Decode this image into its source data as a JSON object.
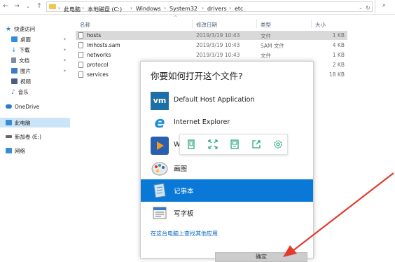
{
  "address": {
    "crumbs": [
      "此电脑",
      "本地磁盘 (C:)",
      "Windows",
      "System32",
      "drivers",
      "etc"
    ]
  },
  "sidebar": {
    "items": [
      {
        "label": "快速访问",
        "icon": "star-icon",
        "color": "#2b7fd1"
      },
      {
        "label": "桌面",
        "icon": "desktop-icon",
        "color": "#2f8fdd",
        "pinned": true
      },
      {
        "label": "下载",
        "icon": "download-icon",
        "color": "#2f8fdd",
        "pinned": true
      },
      {
        "label": "文档",
        "icon": "document-icon",
        "color": "#7a8ea3",
        "pinned": true
      },
      {
        "label": "图片",
        "icon": "picture-icon",
        "color": "#3a7dc8",
        "pinned": true
      },
      {
        "label": "视频",
        "icon": "video-icon",
        "color": "#4a5f80"
      },
      {
        "label": "音乐",
        "icon": "music-icon",
        "color": "#3d7fd0"
      },
      {
        "label": "OneDrive",
        "icon": "cloud-icon",
        "color": "#2b78d0"
      },
      {
        "label": "此电脑",
        "icon": "computer-icon",
        "color": "#3b8bd6",
        "selected": true
      },
      {
        "label": "新加卷 (E:)",
        "icon": "drive-icon",
        "color": "#666666"
      },
      {
        "label": "网络",
        "icon": "network-icon",
        "color": "#3b8bd6"
      }
    ]
  },
  "columns": {
    "name": "名称",
    "modified": "修改日期",
    "type": "类型",
    "size": "大小"
  },
  "files": [
    {
      "name": "hosts",
      "modified": "2019/3/19 10:43",
      "type": "文件",
      "size": "1 KB",
      "selected": true
    },
    {
      "name": "lmhosts.sam",
      "modified": "2019/3/19 10:43",
      "type": "SAM 文件",
      "size": "4 KB"
    },
    {
      "name": "networks",
      "modified": "2019/3/19 10:43",
      "type": "文件",
      "size": "1 KB"
    },
    {
      "name": "protocol",
      "modified": "",
      "type": "",
      "size": "2 KB"
    },
    {
      "name": "services",
      "modified": "",
      "type": "",
      "size": "18 KB"
    }
  ],
  "dialog": {
    "title": "你要如何打开这个文件?",
    "apps": [
      {
        "label": "Default Host Application",
        "icon": "vm-icon",
        "icon_text": "vm"
      },
      {
        "label": "Internet Explorer",
        "icon": "ie-icon",
        "icon_text": "e"
      },
      {
        "label": "W",
        "icon": "media-player-icon"
      },
      {
        "label": "画图",
        "icon": "paint-icon"
      },
      {
        "label": "记事本",
        "icon": "notepad-icon",
        "selected": true
      },
      {
        "label": "写字板",
        "icon": "wordpad-icon"
      }
    ],
    "store_link": "在这台电脑上查找其他应用",
    "ok_label": "确定"
  },
  "toolbar": {
    "tools": [
      "copy-icon",
      "expand-icon",
      "save-icon",
      "share-icon",
      "settings-icon"
    ],
    "color": "#2aa879"
  },
  "colors": {
    "accent": "#0a78d7",
    "arrow": "#e23b2e",
    "selected_row": "#d9d9d9"
  }
}
